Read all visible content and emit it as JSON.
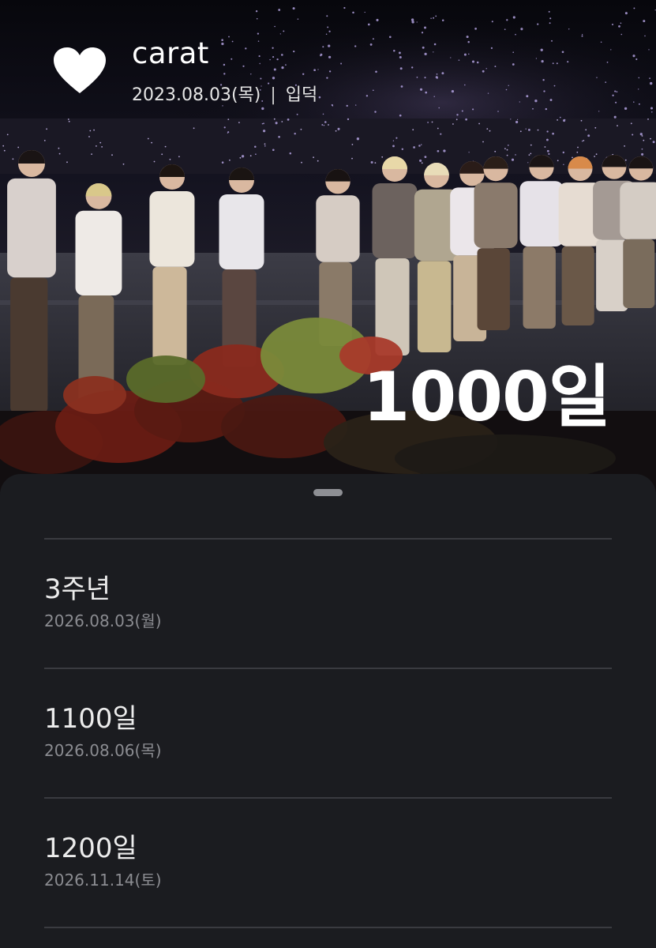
{
  "header": {
    "icon": "heart-icon",
    "title": "carat",
    "date": "2023.08.03(목)",
    "separator": "|",
    "tag": "입덕",
    "count": "1000일"
  },
  "milestones": [
    {
      "title": "3주년",
      "date": "2026.08.03(월)"
    },
    {
      "title": "1100일",
      "date": "2026.08.06(목)"
    },
    {
      "title": "1200일",
      "date": "2026.11.14(토)"
    }
  ],
  "colors": {
    "sheet_background": "#1b1c20",
    "divider": "#3a3b40",
    "title_text": "#ececec",
    "date_text": "#8b8c91"
  }
}
